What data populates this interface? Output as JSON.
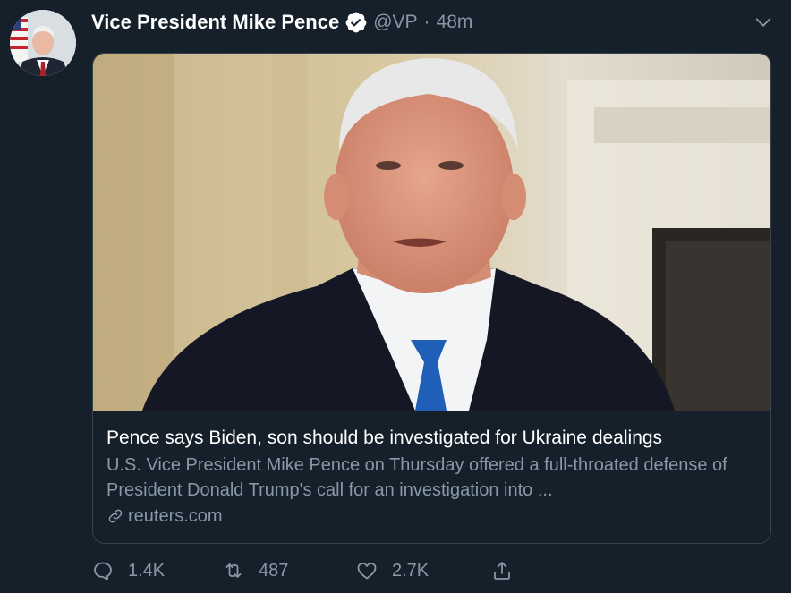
{
  "tweet": {
    "display_name": "Vice President Mike Pence",
    "handle": "@VP",
    "separator": "·",
    "time": "48m",
    "verified": true
  },
  "card": {
    "title": "Pence says Biden, son should be investigated for Ukraine dealings",
    "description": "U.S. Vice President Mike Pence on Thursday offered a full-throated defense of President Donald Trump's call for an investigation into ...",
    "domain": "reuters.com"
  },
  "actions": {
    "reply_count": "1.4K",
    "retweet_count": "487",
    "like_count": "2.7K"
  },
  "icons": {
    "verified": "verified-badge-icon",
    "more": "chevron-down-icon",
    "link": "link-icon",
    "reply": "reply-icon",
    "retweet": "retweet-icon",
    "like": "heart-icon",
    "share": "share-icon"
  },
  "colors": {
    "background": "#15202b",
    "text_primary": "#ffffff",
    "text_secondary": "#8899a6",
    "border": "#38444d",
    "verified": "#ffffff"
  }
}
